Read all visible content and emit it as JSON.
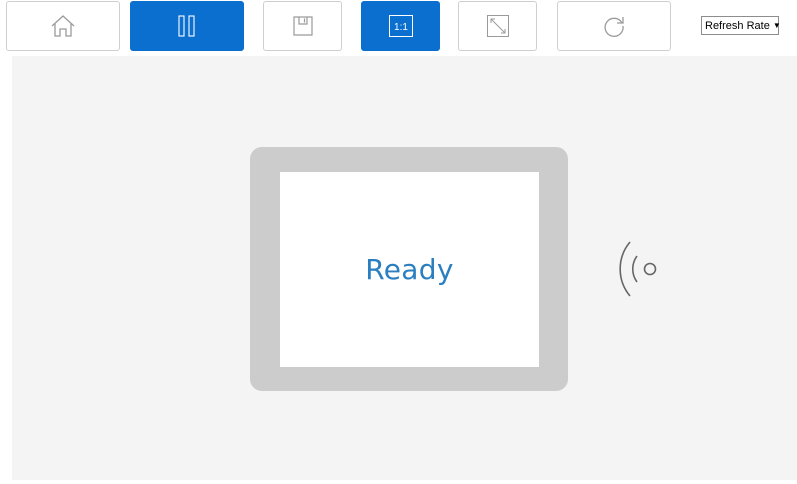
{
  "toolbar": {
    "buttons": [
      {
        "name": "home-button",
        "icon": "home-icon",
        "active": false
      },
      {
        "name": "pause-button",
        "icon": "pause-icon",
        "active": true
      },
      {
        "name": "save-button",
        "icon": "save-icon",
        "active": false
      },
      {
        "name": "actual-size-button",
        "icon": "actual-size-icon",
        "label": "1:1",
        "active": true
      },
      {
        "name": "fit-screen-button",
        "icon": "expand-icon",
        "active": false
      },
      {
        "name": "refresh-button",
        "icon": "refresh-icon",
        "active": false
      }
    ],
    "refresh_rate_label": "Refresh Rate",
    "refresh_rate_arrow": "▼"
  },
  "device": {
    "status": "Ready",
    "wireless_icon": "contactless-signal-icon"
  },
  "colors": {
    "accent": "#0a6fce",
    "status_text": "#2b7fc0",
    "frame": "#cccccc",
    "stage_bg": "#f4f4f4"
  }
}
